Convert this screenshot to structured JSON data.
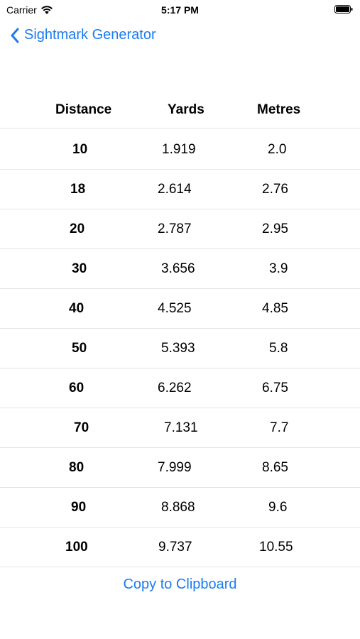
{
  "status_bar": {
    "carrier": "Carrier",
    "time": "5:17 PM",
    "icons": [
      "wifi-icon",
      "battery-icon"
    ]
  },
  "nav": {
    "back_label": "Sightmark Generator",
    "back_icon": "chevron-left-icon",
    "accent_color": "#1a7cf0"
  },
  "table": {
    "headers": [
      "Distance",
      "Yards",
      "Metres"
    ],
    "rows": [
      {
        "distance": "10",
        "yards": "1.919",
        "metres": "2.0"
      },
      {
        "distance": "18",
        "yards": "2.614",
        "metres": "2.76"
      },
      {
        "distance": "20",
        "yards": "2.787",
        "metres": "2.95"
      },
      {
        "distance": "30",
        "yards": "3.656",
        "metres": "3.9"
      },
      {
        "distance": "40",
        "yards": "4.525",
        "metres": "4.85"
      },
      {
        "distance": "50",
        "yards": "5.393",
        "metres": "5.8"
      },
      {
        "distance": "60",
        "yards": "6.262",
        "metres": "6.75"
      },
      {
        "distance": "70",
        "yards": "7.131",
        "metres": "7.7"
      },
      {
        "distance": "80",
        "yards": "7.999",
        "metres": "8.65"
      },
      {
        "distance": "90",
        "yards": "8.868",
        "metres": "9.6"
      },
      {
        "distance": "100",
        "yards": "9.737",
        "metres": "10.55"
      }
    ]
  },
  "actions": {
    "copy_label": "Copy to Clipboard"
  }
}
